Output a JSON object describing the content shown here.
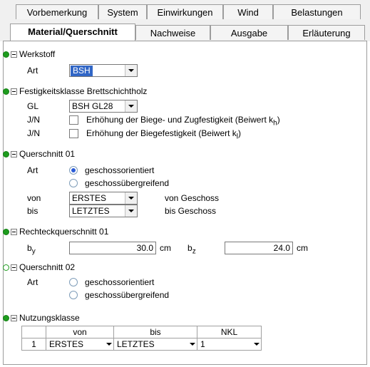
{
  "tabs_row1": [
    "Vorbemerkung",
    "System",
    "Einwirkungen",
    "Wind",
    "Belastungen"
  ],
  "tabs_row2": [
    "Material/Querschnitt",
    "Nachweise",
    "Ausgabe",
    "Erläuterung"
  ],
  "werkstoff": {
    "title": "Werkstoff",
    "art_label": "Art",
    "art_value": "BSH"
  },
  "festigkeit": {
    "title": "Festigkeitsklasse Brettschichtholz",
    "gl_label": "GL",
    "gl_value": "BSH GL28",
    "jn1_label": "J/N",
    "jn1_text": "Erhöhung der Biege- und Zugfestigkeit (Beiwert k",
    "jn1_sub": "h",
    "jn1_close": ")",
    "jn2_label": "J/N",
    "jn2_text": "Erhöhung der Biegefestigkeit (Beiwert k",
    "jn2_sub": "l",
    "jn2_close": ")"
  },
  "querschnitt01": {
    "title": "Querschnitt 01",
    "art_label": "Art",
    "opt1": "geschossorientiert",
    "opt2": "geschossübergreifend",
    "von_label": "von",
    "von_value": "ERSTES",
    "von_text": "von Geschoss",
    "bis_label": "bis",
    "bis_value": "LETZTES",
    "bis_text": "bis Geschoss"
  },
  "rechteck": {
    "title": "Rechteckquerschnitt 01",
    "by_label": "b",
    "by_sub": "y",
    "by_value": "30.0",
    "by_unit": "cm",
    "bz_label": "b",
    "bz_sub": "z",
    "bz_value": "24.0",
    "bz_unit": "cm"
  },
  "querschnitt02": {
    "title": "Querschnitt 02",
    "art_label": "Art",
    "opt1": "geschossorientiert",
    "opt2": "geschossübergreifend"
  },
  "nutzungsklasse": {
    "title": "Nutzungsklasse",
    "headers": [
      "von",
      "bis",
      "NKL"
    ],
    "row": {
      "num": "1",
      "von": "ERSTES",
      "bis": "LETZTES",
      "nkl": "1"
    }
  }
}
